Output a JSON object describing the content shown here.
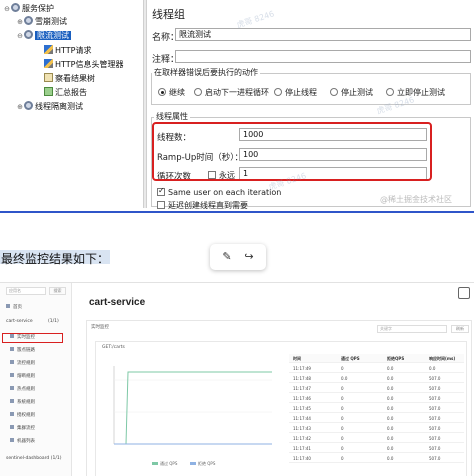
{
  "tree": {
    "items": [
      {
        "label": "服务保护",
        "icon": "gear-icon"
      },
      {
        "label": "雪崩测试",
        "icon": "gear-icon"
      },
      {
        "label": "限流测试",
        "icon": "gear-icon",
        "selected": true
      },
      {
        "label": "HTTP请求",
        "icon": "pencil-icon"
      },
      {
        "label": "HTTP信息头管理器",
        "icon": "wrench-icon"
      },
      {
        "label": "察看结果树",
        "icon": "report-icon"
      },
      {
        "label": "汇总报告",
        "icon": "report-icon"
      },
      {
        "label": "线程隔离测试",
        "icon": "gear-icon"
      }
    ]
  },
  "form": {
    "heading": "线程组",
    "name_label": "名称：",
    "name_value": "限流测试",
    "comment_label": "注释：",
    "comment_value": "",
    "on_error_title": "在取样器错误后要执行的动作",
    "on_error_options": [
      "继续",
      "启动下一进程循环",
      "停止线程",
      "停止测试",
      "立即停止测试"
    ],
    "on_error_selected": "继续",
    "props_title": "线程属性",
    "threads_label": "线程数：",
    "threads_value": "1000",
    "rampup_label": "Ramp-Up时间（秒）：",
    "rampup_value": "100",
    "loop_label": "循环次数",
    "forever_label": "永远",
    "loop_value": "1",
    "same_user_label": "Same user on each iteration",
    "delay_label": "延迟创建线程直到需要"
  },
  "watermarks": [
    "虎哥 8246",
    "@稀土掘金技术社区"
  ],
  "middle": {
    "text": "最终监控结果如下：",
    "toolbar": {
      "edit_icon": "✎",
      "share_icon": "↪"
    }
  },
  "dashboard": {
    "sidebar": {
      "search_placeholder": "应用名",
      "search_button": "搜索",
      "items": [
        "首页",
        "cart-service",
        "实时监控",
        "簇点链路",
        "流控规则",
        "熔断规则",
        "热点规则",
        "系统规则",
        "授权规则",
        "集群流控",
        "机器列表",
        "sentinel-dashboard"
      ],
      "cart_count": "(1/1)",
      "dash_count": "(1/1)"
    },
    "service_title": "cart-service",
    "panel_title": "实时监控",
    "search_placeholder": "关键字",
    "search_button": "刷新",
    "card_title": "GET:/carts",
    "table": {
      "headers": [
        "时间",
        "通过 QPS",
        "拒绝QPS",
        "响应时间(ms)"
      ],
      "rows": [
        [
          "11:17:49",
          "0",
          "0.0",
          "0.0"
        ],
        [
          "11:17:48",
          "0.0",
          "0.0",
          "507.0"
        ],
        [
          "11:17:47",
          "0",
          "0.0",
          "507.0"
        ],
        [
          "11:17:46",
          "0",
          "0.0",
          "507.0"
        ],
        [
          "11:17:45",
          "0",
          "0.0",
          "507.0"
        ],
        [
          "11:17:44",
          "0",
          "0.0",
          "507.0"
        ],
        [
          "11:17:43",
          "0",
          "0.0",
          "507.0"
        ],
        [
          "11:17:42",
          "0",
          "0.0",
          "507.0"
        ],
        [
          "11:17:41",
          "0",
          "0.0",
          "507.0"
        ],
        [
          "11:17:40",
          "0",
          "0.0",
          "507.0"
        ]
      ]
    },
    "chart_legend": [
      "通过 QPS",
      "拒绝 QPS"
    ],
    "colors": {
      "pass": "#7ec8a6",
      "block": "#8fb2e3"
    }
  }
}
